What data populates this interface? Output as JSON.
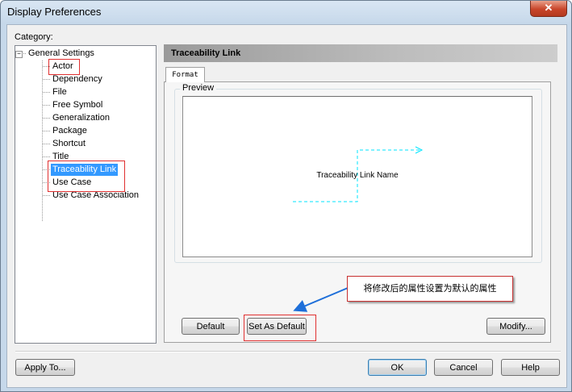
{
  "window": {
    "title": "Display Preferences",
    "close_label": "✕"
  },
  "category": {
    "label": "Category:",
    "root": "General Settings",
    "items": [
      "Actor",
      "Dependency",
      "File",
      "Free Symbol",
      "Generalization",
      "Package",
      "Shortcut",
      "Title",
      "Traceability Link",
      "Use Case",
      "Use Case Association"
    ],
    "selected": "Traceability Link"
  },
  "panel": {
    "header": "Traceability Link",
    "tab": "Format",
    "preview_label": "Preview",
    "preview_text": "Traceability Link Name"
  },
  "buttons": {
    "default": "Default",
    "set_as_default": "Set As Default",
    "modify": "Modify...",
    "apply_to": "Apply To...",
    "ok": "OK",
    "cancel": "Cancel",
    "help": "Help"
  },
  "annotation": {
    "callout": "将修改后的属性设置为默认的属性"
  },
  "colors": {
    "selection": "#3399ff",
    "link_line": "#00e5ff",
    "highlight": "#e03030"
  }
}
